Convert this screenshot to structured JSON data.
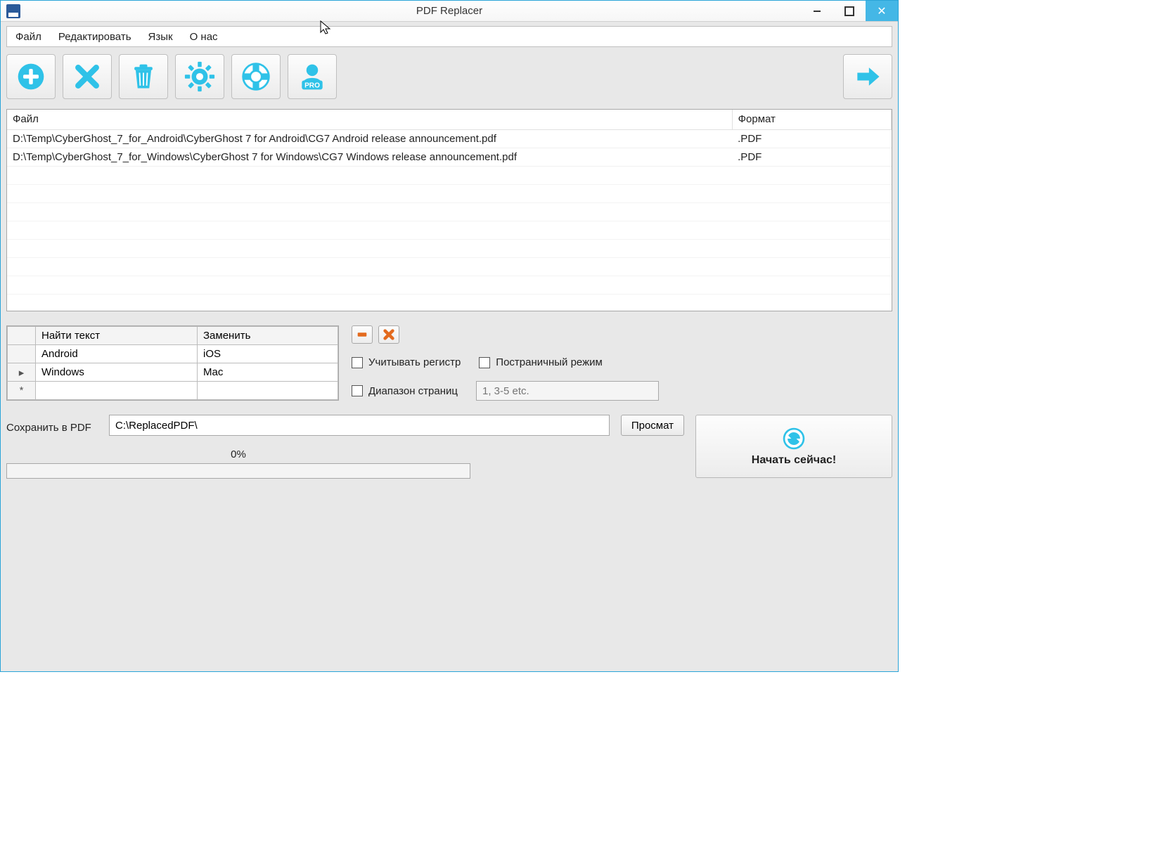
{
  "title": "PDF Replacer",
  "menu": {
    "file": "Файл",
    "edit": "Редактировать",
    "lang": "Язык",
    "about": "О нас"
  },
  "file_table": {
    "header_file": "Файл",
    "header_format": "Формат",
    "rows": [
      {
        "path": "D:\\Temp\\CyberGhost_7_for_Android\\CyberGhost 7 for Android\\CG7 Android release announcement.pdf",
        "fmt": ".PDF"
      },
      {
        "path": "D:\\Temp\\CyberGhost_7_for_Windows\\CyberGhost 7 for Windows\\CG7 Windows release announcement.pdf",
        "fmt": ".PDF"
      }
    ]
  },
  "replace": {
    "header_find": "Найти текст",
    "header_replace": "Заменить",
    "rows": [
      {
        "find": "Android",
        "replace": "iOS"
      },
      {
        "find": "Windows",
        "replace": "Mac"
      }
    ]
  },
  "checks": {
    "case": "Учитывать регистр",
    "page_mode": "Постраничный режим",
    "range": "Диапазон страниц",
    "range_placeholder": "1, 3-5 etc."
  },
  "bottom": {
    "save_label": "Сохранить в PDF",
    "save_path": "C:\\ReplacedPDF\\",
    "browse": "Просмат",
    "start": "Начать сейчас!"
  },
  "progress": {
    "label": "0%"
  }
}
